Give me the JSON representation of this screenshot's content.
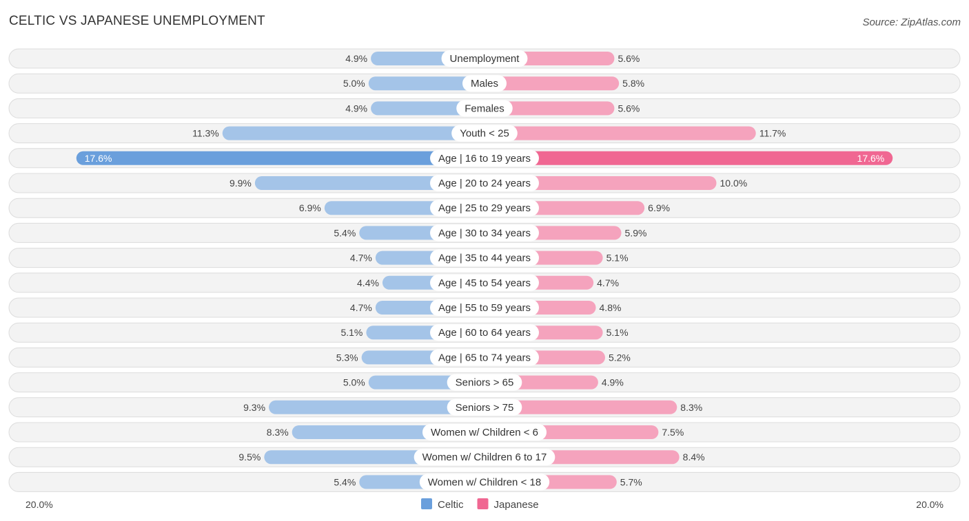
{
  "header": {
    "title": "CELTIC VS JAPANESE UNEMPLOYMENT",
    "source": "Source: ZipAtlas.com"
  },
  "colors": {
    "celtic": "#a4c4e8",
    "celtic_strong": "#6a9fdc",
    "japanese": "#f5a3bd",
    "japanese_strong": "#f06792"
  },
  "chart_data": {
    "type": "bar",
    "orientation": "horizontal-diverging",
    "title": "CELTIC VS JAPANESE UNEMPLOYMENT",
    "categories": [
      "Unemployment",
      "Males",
      "Females",
      "Youth < 25",
      "Age | 16 to 19 years",
      "Age | 20 to 24 years",
      "Age | 25 to 29 years",
      "Age | 30 to 34 years",
      "Age | 35 to 44 years",
      "Age | 45 to 54 years",
      "Age | 55 to 59 years",
      "Age | 60 to 64 years",
      "Age | 65 to 74 years",
      "Seniors > 65",
      "Seniors > 75",
      "Women w/ Children < 6",
      "Women w/ Children 6 to 17",
      "Women w/ Children < 18"
    ],
    "series": [
      {
        "name": "Celtic",
        "side": "left",
        "values": [
          4.9,
          5.0,
          4.9,
          11.3,
          17.6,
          9.9,
          6.9,
          5.4,
          4.7,
          4.4,
          4.7,
          5.1,
          5.3,
          5.0,
          9.3,
          8.3,
          9.5,
          5.4
        ],
        "labels": [
          "4.9%",
          "5.0%",
          "4.9%",
          "11.3%",
          "17.6%",
          "9.9%",
          "6.9%",
          "5.4%",
          "4.7%",
          "4.4%",
          "4.7%",
          "5.1%",
          "5.3%",
          "5.0%",
          "9.3%",
          "8.3%",
          "9.5%",
          "5.4%"
        ]
      },
      {
        "name": "Japanese",
        "side": "right",
        "values": [
          5.6,
          5.8,
          5.6,
          11.7,
          17.6,
          10.0,
          6.9,
          5.9,
          5.1,
          4.7,
          4.8,
          5.1,
          5.2,
          4.9,
          8.3,
          7.5,
          8.4,
          5.7
        ],
        "labels": [
          "5.6%",
          "5.8%",
          "5.6%",
          "11.7%",
          "17.6%",
          "10.0%",
          "6.9%",
          "5.9%",
          "5.1%",
          "4.7%",
          "4.8%",
          "5.1%",
          "5.2%",
          "4.9%",
          "8.3%",
          "7.5%",
          "8.4%",
          "5.7%"
        ]
      }
    ],
    "xlim": [
      -20,
      20
    ],
    "axis_labels": {
      "left": "20.0%",
      "right": "20.0%"
    },
    "legend": {
      "placement": "bottom-center",
      "entries": [
        "Celtic",
        "Japanese"
      ]
    },
    "unit": "%"
  }
}
